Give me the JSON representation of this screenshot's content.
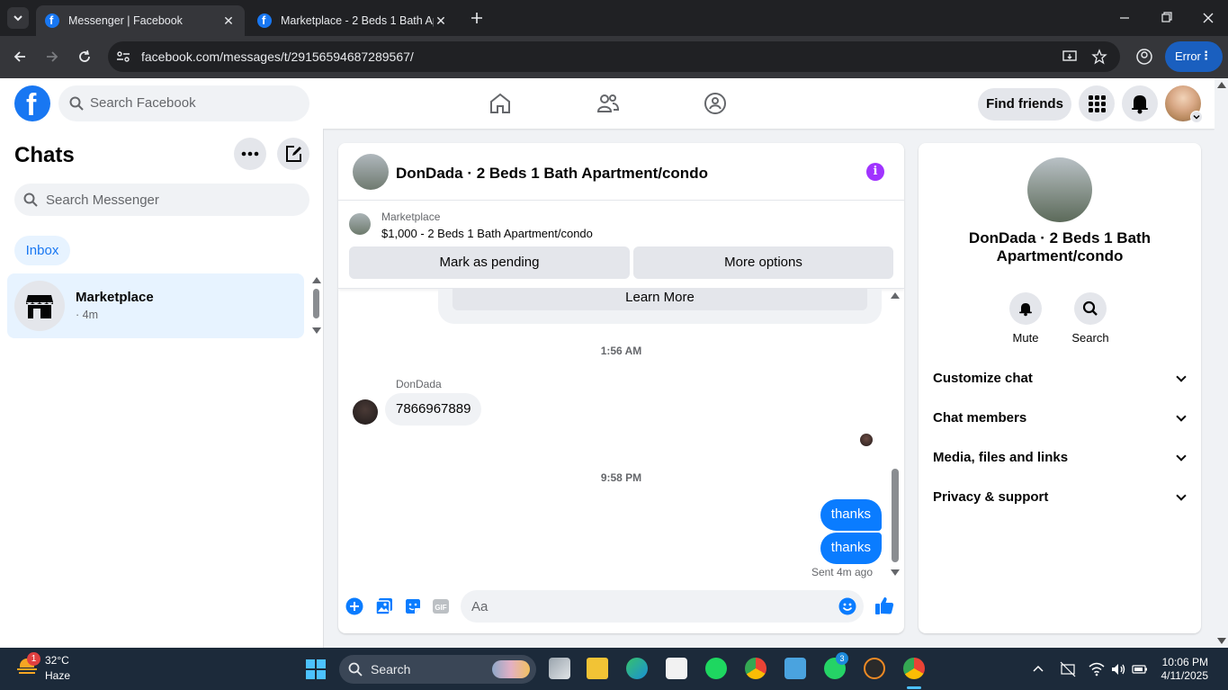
{
  "browser": {
    "tabs": [
      {
        "title": "Messenger | Facebook",
        "active": true
      },
      {
        "title": "Marketplace - 2 Beds 1 Bath Ap",
        "active": false
      }
    ],
    "url": "facebook.com/messages/t/29156594687289567/",
    "error_label": "Error"
  },
  "fb_header": {
    "search_placeholder": "Search Facebook",
    "find_friends": "Find friends"
  },
  "sidebar": {
    "title": "Chats",
    "search_placeholder": "Search Messenger",
    "filter": "Inbox",
    "chats": [
      {
        "name": "Marketplace",
        "time": "· 4m"
      }
    ]
  },
  "chat": {
    "title": "DonDada · 2 Beds 1 Bath Apartment/condo",
    "marketplace_label": "Marketplace",
    "listing": "$1,000 - 2 Beds 1 Bath Apartment/condo",
    "mark_pending": "Mark as pending",
    "more_options": "More options",
    "learn_more": "Learn More",
    "timestamp1": "1:56 AM",
    "sender": "DonDada",
    "incoming_message": "7866967889",
    "timestamp2": "9:58 PM",
    "outgoing": [
      "thanks",
      "thanks"
    ],
    "sent_status": "Sent 4m ago",
    "composer_placeholder": "Aa"
  },
  "details": {
    "name": "DonDada · 2 Beds 1 Bath Apartment/condo",
    "actions": [
      "Mute",
      "Search"
    ],
    "sections": [
      "Customize chat",
      "Chat members",
      "Media, files and links",
      "Privacy & support"
    ]
  },
  "taskbar": {
    "temperature": "32°C",
    "weather": "Haze",
    "weather_badge": "1",
    "search": "Search",
    "whatsapp_badge": "3",
    "time": "10:06 PM",
    "date": "4/11/2025"
  },
  "colors": {
    "fb_blue": "#1877f2",
    "messenger_blue": "#0a7cff",
    "info_purple": "#a033ff",
    "error_button": "#1a5fbf"
  }
}
